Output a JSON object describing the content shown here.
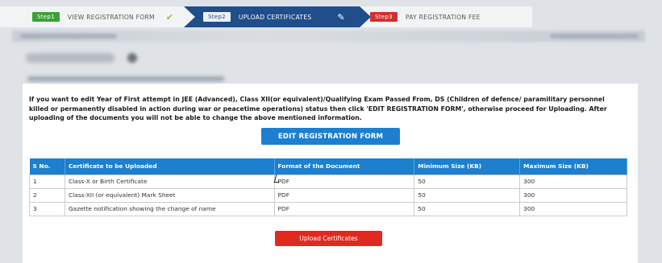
{
  "stepper": {
    "steps": [
      {
        "num": "Step1",
        "label": "VIEW REGISTRATION FORM",
        "icon": "checkmark-icon"
      },
      {
        "num": "Step2",
        "label": "UPLOAD CERTIFICATES",
        "icon": "pencil-icon"
      },
      {
        "num": "Step3",
        "label": "PAY REGISTRATION FEE"
      }
    ]
  },
  "notice": "If you want to edit Year of First attempt in JEE (Advanced), Class XII(or equivalent)/Qualifying Exam Passed From, DS (Children of defence/ paramilitary personnel killed or permanently disabled in action during war or peacetime operations) status then click 'EDIT REGISTRATION FORM', otherwise proceed for Uploading. After uploading of the documents you will not be able to change the above mentioned information.",
  "buttons": {
    "edit": "EDIT REGISTRATION FORM",
    "upload": "Upload Certificates"
  },
  "table": {
    "headers": [
      "S No.",
      "Certificate to be Uploaded",
      "Format of the Document",
      "Minimum Size (KB)",
      "Maximum Size (KB)"
    ],
    "rows": [
      [
        "1",
        "Class-X or Birth Certificate",
        "PDF",
        "50",
        "300"
      ],
      [
        "2",
        "Class-XII (or equivalent) Mark Sheet",
        "PDF",
        "50",
        "300"
      ],
      [
        "3",
        "Gazette notification showing the change of name",
        "PDF",
        "50",
        "300"
      ]
    ]
  },
  "colors": {
    "active_step": "#1f4e8a",
    "primary_button": "#1c7fd0",
    "danger_button": "#e02a1f",
    "step1_badge": "#3aa335",
    "step3_badge": "#d62d2d"
  }
}
